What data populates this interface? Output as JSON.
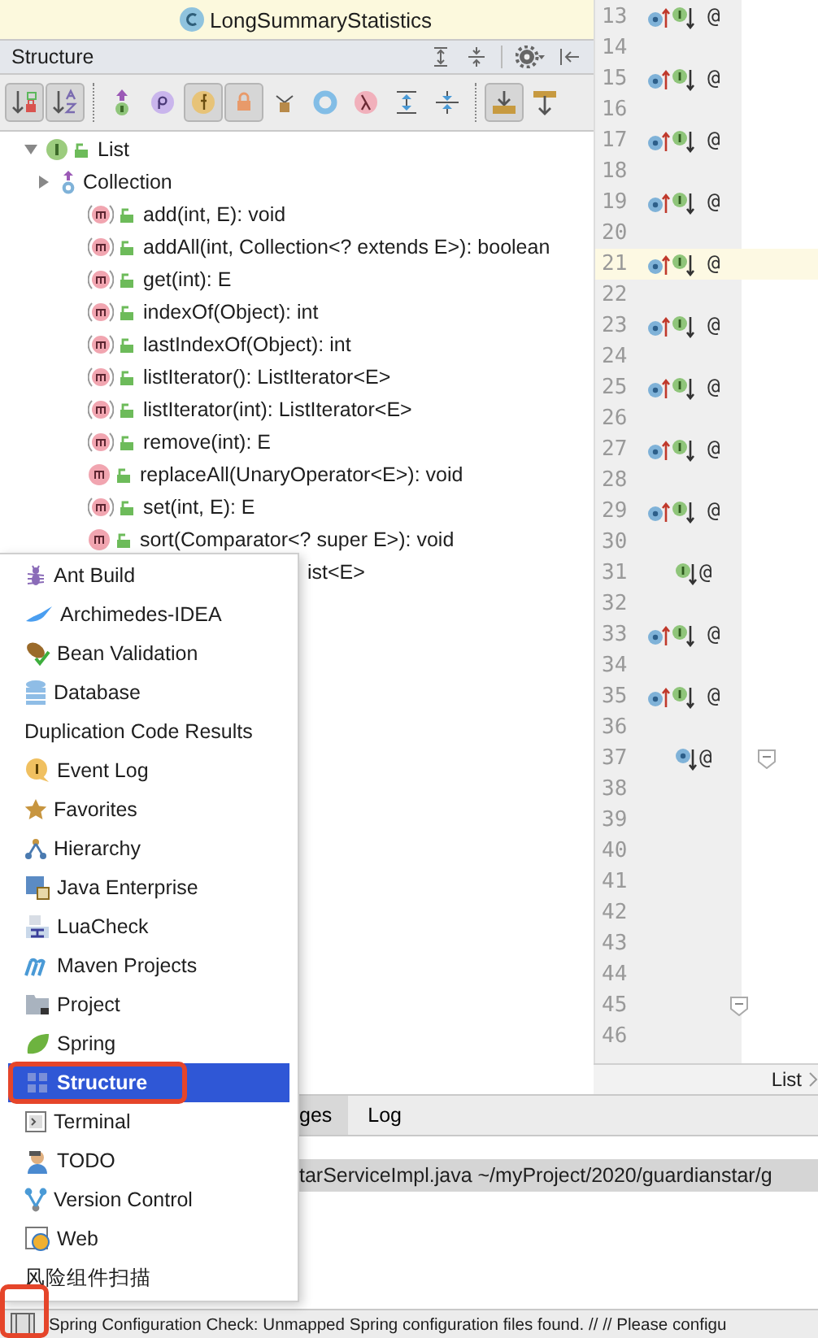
{
  "top_list": {
    "items": [
      {
        "label": "LongSummaryStatistics"
      }
    ]
  },
  "structure": {
    "title": "Structure",
    "header_buttons": [
      {
        "kind": "expand"
      },
      {
        "kind": "collapse"
      },
      {
        "kind": "gear"
      },
      {
        "kind": "hide"
      }
    ],
    "toolbar": [
      {
        "buttons": [
          {
            "kind": "sort_visibility",
            "on": true
          },
          {
            "kind": "sort_alpha",
            "on": true
          }
        ]
      },
      {
        "buttons": [
          {
            "kind": "inherited",
            "on": false
          },
          {
            "kind": "properties",
            "on": false
          },
          {
            "kind": "fields",
            "on": true
          },
          {
            "kind": "non_public",
            "on": true
          },
          {
            "kind": "anonymous",
            "on": false
          },
          {
            "kind": "lambda_ring",
            "on": false
          },
          {
            "kind": "lambda",
            "on": false
          },
          {
            "kind": "expand_all",
            "on": false
          },
          {
            "kind": "collapse_all",
            "on": false
          }
        ]
      },
      {
        "buttons": [
          {
            "kind": "scroll_to_source",
            "on": true
          },
          {
            "kind": "scroll_from_source",
            "on": false
          }
        ]
      }
    ],
    "tree": [
      {
        "label": "List",
        "kind": "interface",
        "expanded": true,
        "children": [
          {
            "label": "Collection",
            "kind": "inherited",
            "expanded": false
          },
          {
            "label": "add(int, E): void",
            "kind": "method",
            "abstract": true
          },
          {
            "label": "addAll(int, Collection<? extends E>): boolean",
            "kind": "method",
            "abstract": true
          },
          {
            "label": "get(int): E",
            "kind": "method",
            "abstract": true
          },
          {
            "label": "indexOf(Object): int",
            "kind": "method",
            "abstract": true
          },
          {
            "label": "lastIndexOf(Object): int",
            "kind": "method",
            "abstract": true
          },
          {
            "label": "listIterator(): ListIterator<E>",
            "kind": "method",
            "abstract": true
          },
          {
            "label": "listIterator(int): ListIterator<E>",
            "kind": "method",
            "abstract": true
          },
          {
            "label": "remove(int): E",
            "kind": "method",
            "abstract": true
          },
          {
            "label": "replaceAll(UnaryOperator<E>): void",
            "kind": "method",
            "abstract": false
          },
          {
            "label": "set(int, E): E",
            "kind": "method",
            "abstract": true
          },
          {
            "label": "sort(Comparator<? super E>): void",
            "kind": "method",
            "abstract": false
          },
          {
            "label": "ist<E>",
            "kind": "covered"
          }
        ]
      }
    ]
  },
  "gutter": {
    "lines": [
      {
        "number": "13",
        "kind": "override_implement",
        "annotation": "@",
        "fold": false,
        "current": false
      },
      {
        "number": "14",
        "kind": "none",
        "fold": false,
        "current": false
      },
      {
        "number": "15",
        "kind": "override_implement",
        "annotation": "@",
        "fold": false,
        "current": false
      },
      {
        "number": "16",
        "kind": "none",
        "fold": false,
        "current": false
      },
      {
        "number": "17",
        "kind": "override_implement",
        "annotation": "@",
        "fold": false,
        "current": false
      },
      {
        "number": "18",
        "kind": "none",
        "fold": false,
        "current": false
      },
      {
        "number": "19",
        "kind": "override_implement",
        "annotation": "@",
        "fold": false,
        "current": false
      },
      {
        "number": "20",
        "kind": "none",
        "fold": false,
        "current": false
      },
      {
        "number": "21",
        "kind": "override_implement",
        "annotation": "@",
        "fold": false,
        "current": true
      },
      {
        "number": "22",
        "kind": "none",
        "fold": false,
        "current": false
      },
      {
        "number": "23",
        "kind": "override_implement",
        "annotation": "@",
        "fold": false,
        "current": false
      },
      {
        "number": "24",
        "kind": "none",
        "fold": false,
        "current": false
      },
      {
        "number": "25",
        "kind": "override_implement",
        "annotation": "@",
        "fold": false,
        "current": false
      },
      {
        "number": "26",
        "kind": "none",
        "fold": false,
        "current": false
      },
      {
        "number": "27",
        "kind": "override_implement",
        "annotation": "@",
        "fold": false,
        "current": false
      },
      {
        "number": "28",
        "kind": "none",
        "fold": false,
        "current": false
      },
      {
        "number": "29",
        "kind": "override_implement",
        "annotation": "@",
        "fold": false,
        "current": false
      },
      {
        "number": "30",
        "kind": "none",
        "fold": false,
        "current": false
      },
      {
        "number": "31",
        "kind": "implement",
        "annotation": "@",
        "fold": false,
        "current": false
      },
      {
        "number": "32",
        "kind": "none",
        "fold": false,
        "current": false
      },
      {
        "number": "33",
        "kind": "override_implement",
        "annotation": "@",
        "fold": false,
        "current": false
      },
      {
        "number": "34",
        "kind": "none",
        "fold": false,
        "current": false
      },
      {
        "number": "35",
        "kind": "override_implement",
        "annotation": "@",
        "fold": false,
        "current": false
      },
      {
        "number": "36",
        "kind": "none",
        "fold": false,
        "current": false
      },
      {
        "number": "37",
        "kind": "overridden",
        "annotation": "@",
        "fold": true,
        "current": false
      },
      {
        "number": "38",
        "kind": "none",
        "fold": false,
        "current": false
      },
      {
        "number": "39",
        "kind": "none",
        "fold": false,
        "current": false
      },
      {
        "number": "40",
        "kind": "none",
        "fold": false,
        "current": false
      },
      {
        "number": "41",
        "kind": "none",
        "fold": false,
        "current": false
      },
      {
        "number": "42",
        "kind": "none",
        "fold": false,
        "current": false
      },
      {
        "number": "43",
        "kind": "none",
        "fold": false,
        "current": false
      },
      {
        "number": "44",
        "kind": "none",
        "fold": false,
        "current": false
      },
      {
        "number": "45",
        "kind": "none",
        "fold": true,
        "current": false
      },
      {
        "number": "46",
        "kind": "none",
        "fold": false,
        "current": false
      }
    ]
  },
  "breadcrumb": {
    "label": "List"
  },
  "tool_windows_menu": {
    "items": [
      {
        "label": "Ant Build",
        "kind": "ant",
        "selected": false
      },
      {
        "label": "Archimedes-IDEA",
        "kind": "archimedes",
        "selected": false
      },
      {
        "label": "Bean Validation",
        "kind": "bean",
        "selected": false
      },
      {
        "label": "Database",
        "kind": "database",
        "selected": false
      },
      {
        "label": "Duplication Code Results",
        "kind": "plain",
        "selected": false
      },
      {
        "label": "Event Log",
        "kind": "event_log",
        "selected": false
      },
      {
        "label": "Favorites",
        "kind": "favorites",
        "selected": false
      },
      {
        "label": "Hierarchy",
        "kind": "hierarchy",
        "selected": false
      },
      {
        "label": "Java Enterprise",
        "kind": "java_ee",
        "selected": false
      },
      {
        "label": "LuaCheck",
        "kind": "luacheck",
        "selected": false
      },
      {
        "label": "Maven Projects",
        "kind": "maven",
        "selected": false
      },
      {
        "label": "Project",
        "kind": "project",
        "selected": false
      },
      {
        "label": "Spring",
        "kind": "spring",
        "selected": false
      },
      {
        "label": "Structure",
        "kind": "structure",
        "selected": true
      },
      {
        "label": "Terminal",
        "kind": "terminal",
        "selected": false
      },
      {
        "label": "TODO",
        "kind": "todo",
        "selected": false
      },
      {
        "label": "Version Control",
        "kind": "vcs",
        "selected": false
      },
      {
        "label": "Web",
        "kind": "web",
        "selected": false
      },
      {
        "label": "风险组件扫描",
        "kind": "plain",
        "selected": false
      }
    ]
  },
  "version_control": {
    "tabs": [
      {
        "label": "ges",
        "selected": true
      },
      {
        "label": "Log",
        "selected": false
      }
    ],
    "rows": [
      {
        "text": "tarServiceImpl.java  ~/myProject/2020/guardianstar/g",
        "selected": true
      }
    ]
  },
  "status_bar": {
    "message": "Spring Configuration Check: Unmapped Spring configuration files found. // // Please configu"
  }
}
